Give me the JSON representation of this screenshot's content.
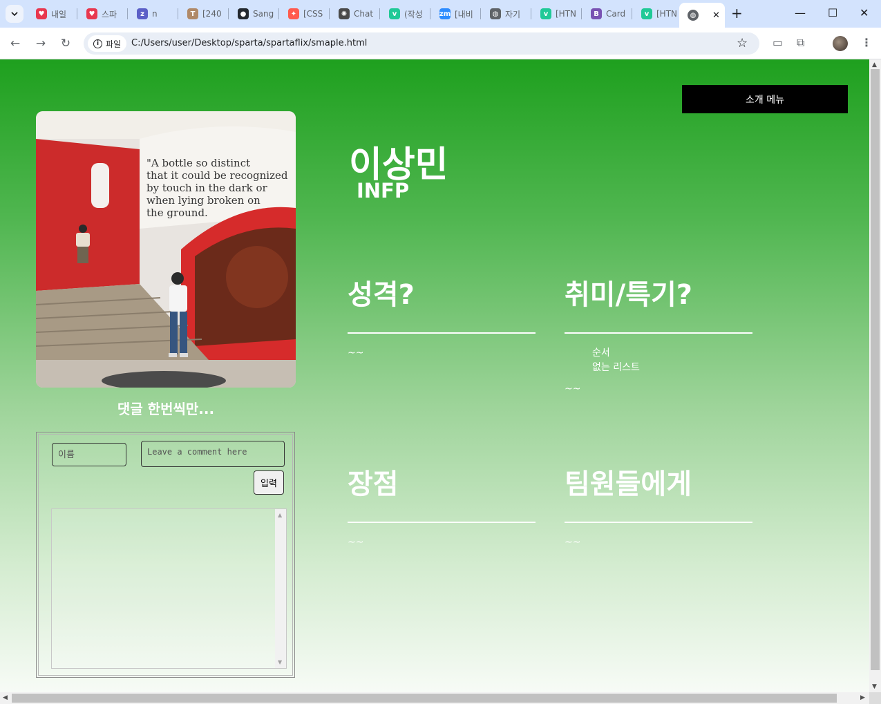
{
  "browser": {
    "tabs": [
      {
        "title": "내일",
        "fav_color": "#e8384f",
        "fav_glyph": "♥"
      },
      {
        "title": "스파",
        "fav_color": "#e8384f",
        "fav_glyph": "♥"
      },
      {
        "title": "n",
        "fav_color": "#5b5fc7",
        "fav_glyph": "z"
      },
      {
        "title": "[240",
        "fav_color": "#b08968",
        "fav_glyph": "T"
      },
      {
        "title": "Sang",
        "fav_color": "#24292f",
        "fav_glyph": "●"
      },
      {
        "title": "[CSS",
        "fav_color": "#ff5a4e",
        "fav_glyph": "✦"
      },
      {
        "title": "Chat",
        "fav_color": "#4a4a4a",
        "fav_glyph": "✺"
      },
      {
        "title": "(작성",
        "fav_color": "#20c997",
        "fav_glyph": "v"
      },
      {
        "title": "[내비",
        "fav_color": "#2d8cff",
        "fav_glyph": "zm"
      },
      {
        "title": "자기",
        "fav_color": "#5f6368",
        "fav_glyph": "◍"
      },
      {
        "title": "[HTN",
        "fav_color": "#20c997",
        "fav_glyph": "v"
      },
      {
        "title": "Card",
        "fav_color": "#7952b3",
        "fav_glyph": "B"
      },
      {
        "title": "[HTN",
        "fav_color": "#20c997",
        "fav_glyph": "v"
      }
    ],
    "active_tab": {
      "title": "",
      "close": "✕"
    },
    "new_tab": "+",
    "file_chip": "파일",
    "url": "C:/Users/user/Desktop/sparta/spartaflix/smaple.html"
  },
  "page": {
    "menu_button": "소개 메뉴",
    "name": "이상민",
    "mbti": "INFP",
    "photo_caption": "댓글 한번씩만...",
    "comment_form": {
      "name_placeholder": "이름",
      "comment_placeholder": "Leave a comment here",
      "submit_label": "입력"
    },
    "sections": {
      "personality": {
        "title": "성격?",
        "body": "~~"
      },
      "hobbies": {
        "title": "취미/특기?",
        "list": [
          "순서",
          "없는 리스트"
        ],
        "body": "~~"
      },
      "strengths": {
        "title": "장점",
        "body": "~~"
      },
      "to_team": {
        "title": "팀원들에게",
        "body": "~~"
      }
    }
  },
  "colors": {
    "gradient_top": "#1ea01e",
    "gradient_bottom": "#f7fbf6",
    "menu_button_bg": "#000000",
    "text": "#ffffff"
  }
}
